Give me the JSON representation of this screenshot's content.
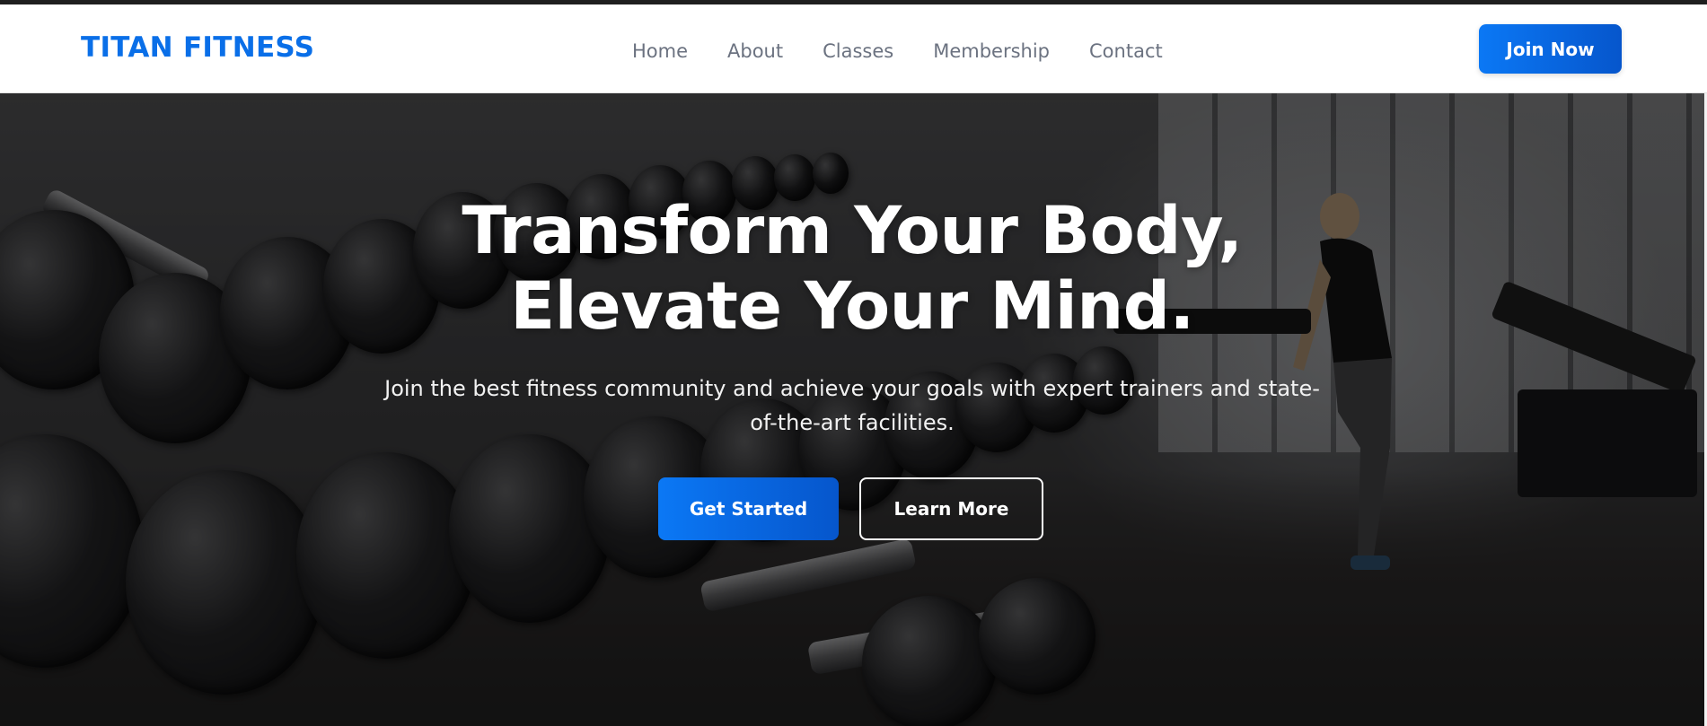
{
  "brand": {
    "name": "TITAN FITNESS"
  },
  "nav": {
    "items": [
      {
        "label": "Home"
      },
      {
        "label": "About"
      },
      {
        "label": "Classes"
      },
      {
        "label": "Membership"
      },
      {
        "label": "Contact"
      }
    ],
    "cta_label": "Join Now"
  },
  "hero": {
    "title_line1": "Transform Your Body,",
    "title_line2": "Elevate Your Mind.",
    "subtitle": "Join the best fitness community and achieve your goals with expert trainers and state-of-the-art facilities.",
    "primary_cta": "Get Started",
    "secondary_cta": "Learn More"
  },
  "colors": {
    "accent": "#0a6fe8",
    "nav_text": "#6b7280",
    "hero_text": "#ffffff"
  }
}
